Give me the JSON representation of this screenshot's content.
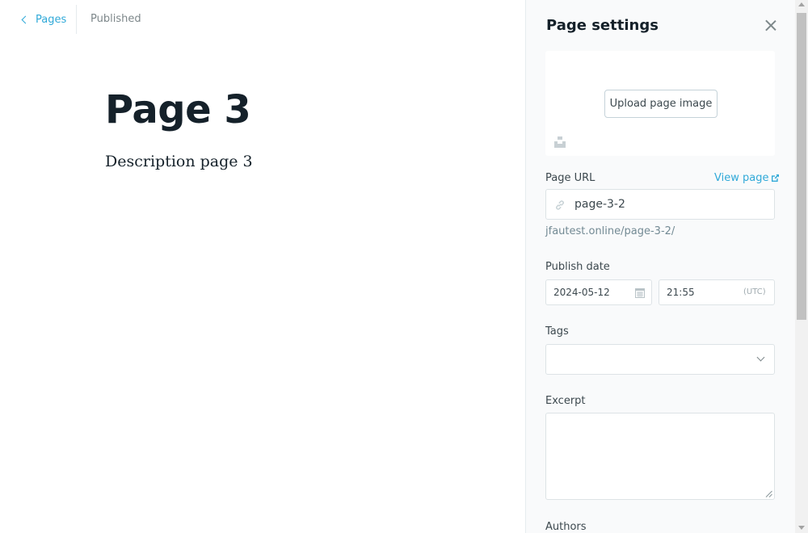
{
  "header": {
    "back_label": "Pages",
    "status": "Published"
  },
  "editor": {
    "title": "Page 3",
    "body": "Description page 3"
  },
  "settings": {
    "title": "Page settings",
    "upload_label": "Upload page image",
    "page_url_label": "Page URL",
    "view_page_label": "View page",
    "url_value": "page-3-2",
    "url_preview": "jfautest.online/page-3-2/",
    "publish_date_label": "Publish date",
    "date_value": "2024-05-12",
    "time_value": "21:55",
    "timezone": "(UTC)",
    "tags_label": "Tags",
    "excerpt_label": "Excerpt",
    "excerpt_value": "",
    "authors_label": "Authors"
  },
  "colors": {
    "accent": "#30a9d8",
    "text": "#15212a",
    "muted": "#7d878a",
    "panel_bg": "#f9fafb",
    "border": "#dde3e6"
  },
  "icons": [
    "chevron-left-icon",
    "close-icon",
    "unsplash-icon",
    "external-link-icon",
    "link-icon",
    "calendar-icon",
    "chevron-down-icon"
  ]
}
